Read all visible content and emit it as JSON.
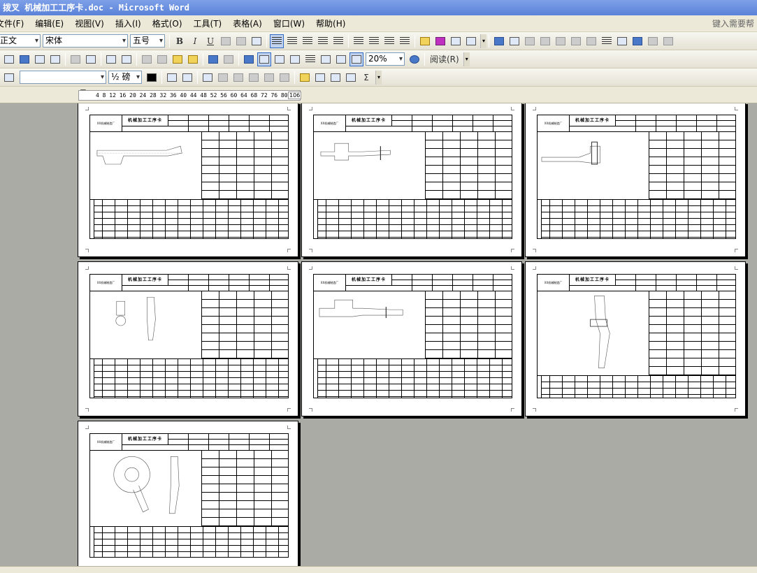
{
  "window": {
    "title": "拨叉 机械加工工序卡.doc - Microsoft Word"
  },
  "menu": {
    "items": [
      "文件(F)",
      "编辑(E)",
      "视图(V)",
      "插入(I)",
      "格式(O)",
      "工具(T)",
      "表格(A)",
      "窗口(W)",
      "帮助(H)"
    ],
    "help_placeholder": "键入需要帮助的问题"
  },
  "toolbar_formatting": {
    "style": "正文",
    "font": "宋体",
    "size": "五号",
    "bold": "B",
    "italic": "I",
    "underline": "U"
  },
  "toolbar_standard": {
    "zoom": "20%",
    "read_label": "阅读(R)"
  },
  "toolbar_drawing": {
    "line_weight": "½ 磅",
    "sum": "Σ"
  },
  "ruler": {
    "ticks": "4 8 12 16 20 24 28 32 36 40 44 48 52 56 60 64 68 72 76 80 84 88 92 96",
    "end_value": "106"
  },
  "pages": [
    {
      "card_title": "机械加工工序卡",
      "company": "XX机械制造厂"
    },
    {
      "card_title": "机械加工工序卡",
      "company": "XX机械制造厂"
    },
    {
      "card_title": "机械加工工序卡",
      "company": "XX机械制造厂"
    },
    {
      "card_title": "机械加工工序卡",
      "company": "XX机械制造厂"
    },
    {
      "card_title": "机械加工工序卡",
      "company": "XX机械制造厂"
    },
    {
      "card_title": "机械加工工序卡",
      "company": "XX机械制造厂"
    },
    {
      "card_title": "机械加工工序卡",
      "company": "XX机械制造厂"
    }
  ]
}
